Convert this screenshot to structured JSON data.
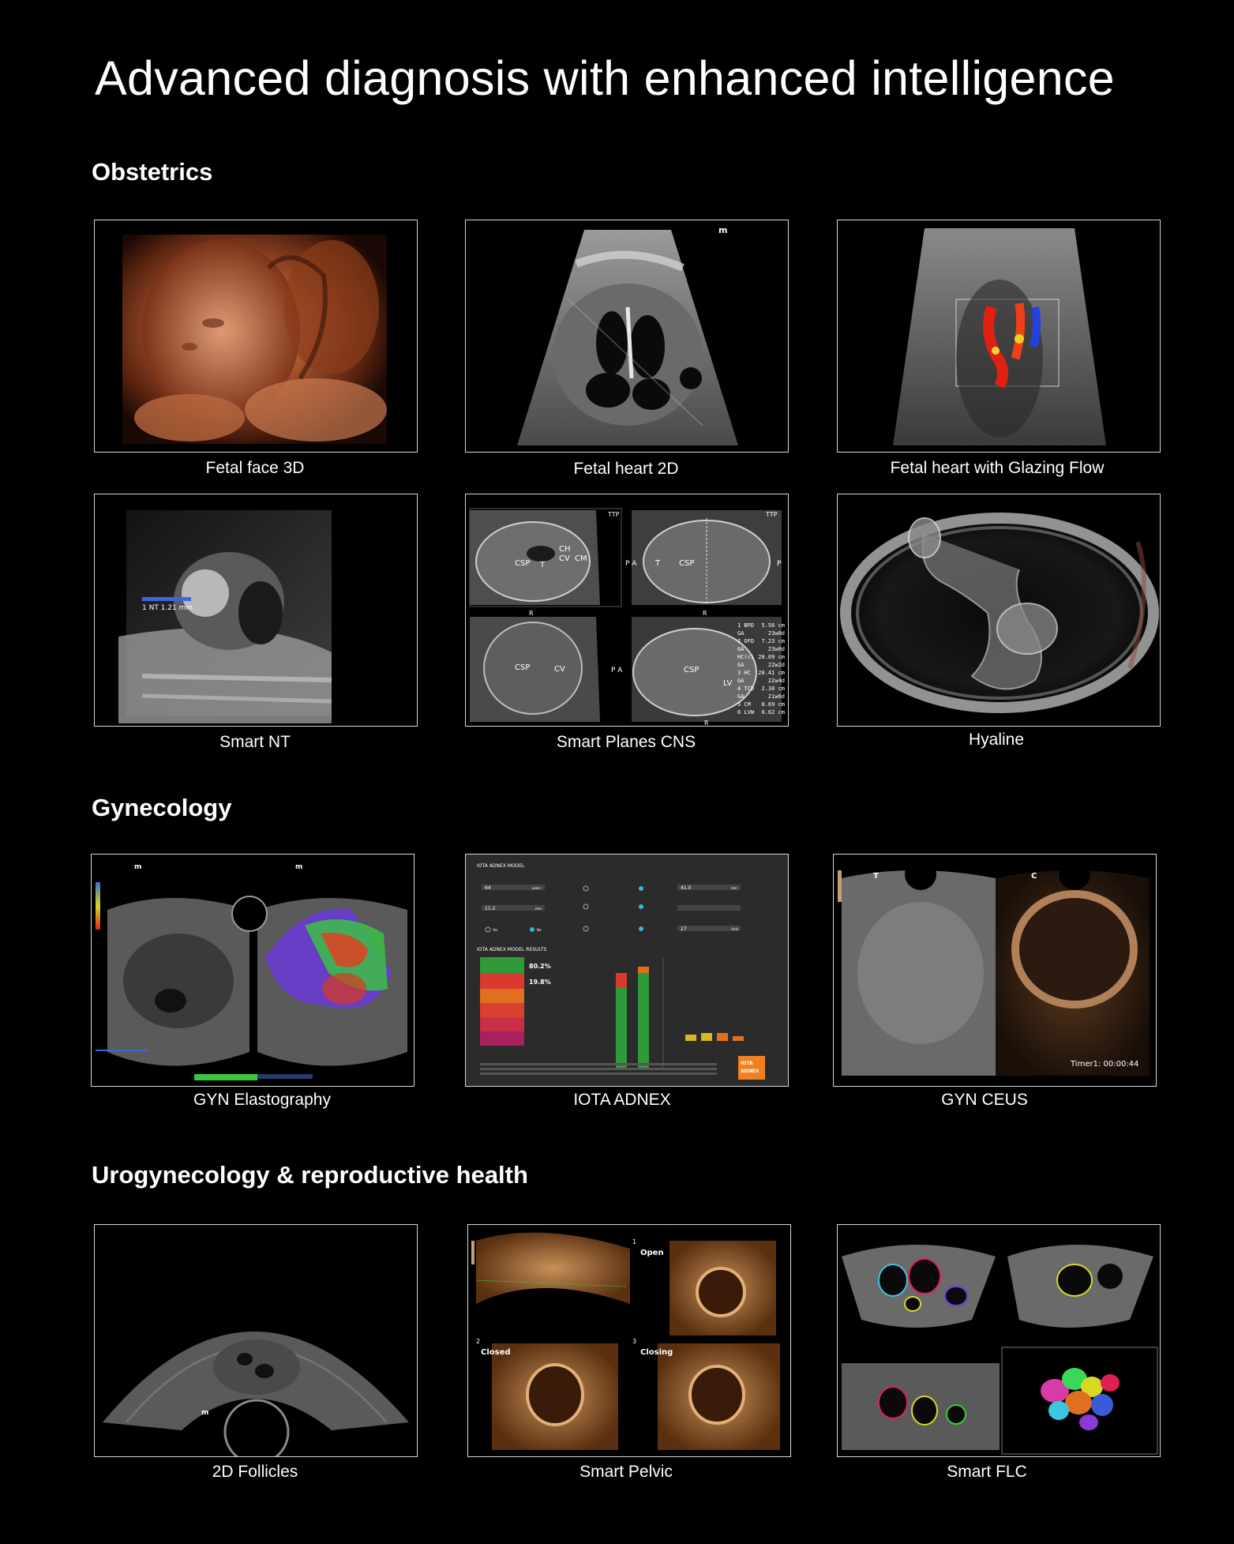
{
  "page": {
    "title": "Advanced diagnosis with enhanced intelligence"
  },
  "sections": [
    {
      "heading": "Obstetrics",
      "items": [
        {
          "caption": "Fetal face 3D",
          "image": "ultrasound-3d-fetal-face"
        },
        {
          "caption": "Fetal heart 2D",
          "image": "ultrasound-2d-fetal-heart"
        },
        {
          "caption": "Fetal heart with Glazing Flow",
          "image": "ultrasound-color-flow-heart"
        },
        {
          "caption": "Smart NT",
          "image": "ultrasound-nuchal-translucency"
        },
        {
          "caption": "Smart Planes CNS",
          "image": "ultrasound-cns-planes"
        },
        {
          "caption": "Hyaline",
          "image": "ultrasound-hyaline-render"
        }
      ]
    },
    {
      "heading": "Gynecology",
      "items": [
        {
          "caption": "GYN Elastography",
          "image": "ultrasound-elastography"
        },
        {
          "caption": "IOTA ADNEX",
          "image": "iota-adnex-report"
        },
        {
          "caption": "GYN CEUS",
          "image": "ultrasound-contrast-enhanced"
        }
      ]
    },
    {
      "heading": "Urogynecology & reproductive health",
      "items": [
        {
          "caption": "2D Follicles",
          "image": "ultrasound-follicles"
        },
        {
          "caption": "Smart Pelvic",
          "image": "ultrasound-pelvic-floor"
        },
        {
          "caption": "Smart FLC",
          "image": "ultrasound-follicle-count"
        }
      ]
    }
  ],
  "image_text": {
    "m": "m",
    "nt_measure": "1 NT  1.21 mm",
    "cns": {
      "csp": "CSP",
      "t": "T",
      "ch": "CH",
      "cv": "CV",
      "cm": "CM",
      "pa": "P A",
      "p": "P",
      "r": "R",
      "ttp": "TTP",
      "lv": "LV",
      "measure_labels": [
        "1 BPD",
        "GA",
        "2 OFD",
        "GA",
        "HC(c)",
        "GA",
        "3 HC",
        "GA",
        "4 TCD",
        "GA",
        "5 CM",
        "6 LVW"
      ],
      "measure_values": [
        "5.56 cm",
        "23w0d",
        "7.23 cm",
        "23w0d",
        "20.09 cm",
        "22w2d",
        "20.41 cm",
        "22w4d",
        "2.38 cm",
        "21w6d",
        "0.69 cm",
        "0.62 cm"
      ]
    },
    "iota": {
      "model_title": "IOTA ADNEX MODEL",
      "results_title": "IOTA ADNEX MODEL RESULTS",
      "age_value": "64",
      "age_unit": "years",
      "lesion_value": "11.2",
      "lesion_unit": "mm",
      "max_value": "41.0",
      "max_unit": "mm",
      "serum_value": "27",
      "serum_unit": "U/ml",
      "benign_pct": "80.2%",
      "malignant_pct": "19.8%",
      "yes": "Yes",
      "no": "No",
      "logo_line1": "IOTA",
      "logo_line2": "ADNEX"
    },
    "ceus": {
      "t": "T",
      "c": "C",
      "timer": "Timer1: 00:00:44"
    },
    "pelvic": {
      "open": "Open",
      "closed": "Closed",
      "closing": "Closing",
      "n1": "1",
      "n2": "2",
      "n3": "3"
    }
  }
}
